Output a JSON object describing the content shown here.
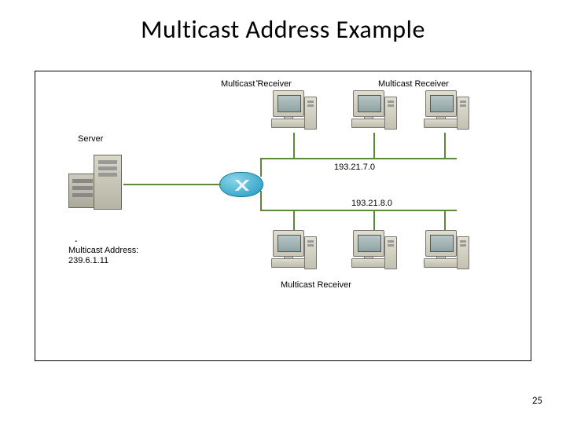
{
  "title": "Multicast Address Example",
  "labels": {
    "server": "Server",
    "receiver_top1": "Multicast Receiver",
    "receiver_top2": "Multicast Receiver",
    "receiver_bottom": "Multicast Receiver",
    "mcast_addr_line1": "Multicast Address:",
    "mcast_addr_line2": "239.6.1.11",
    "net1": "193.21.7.0",
    "net2": "193.21.8.0"
  },
  "slide_number": "25"
}
